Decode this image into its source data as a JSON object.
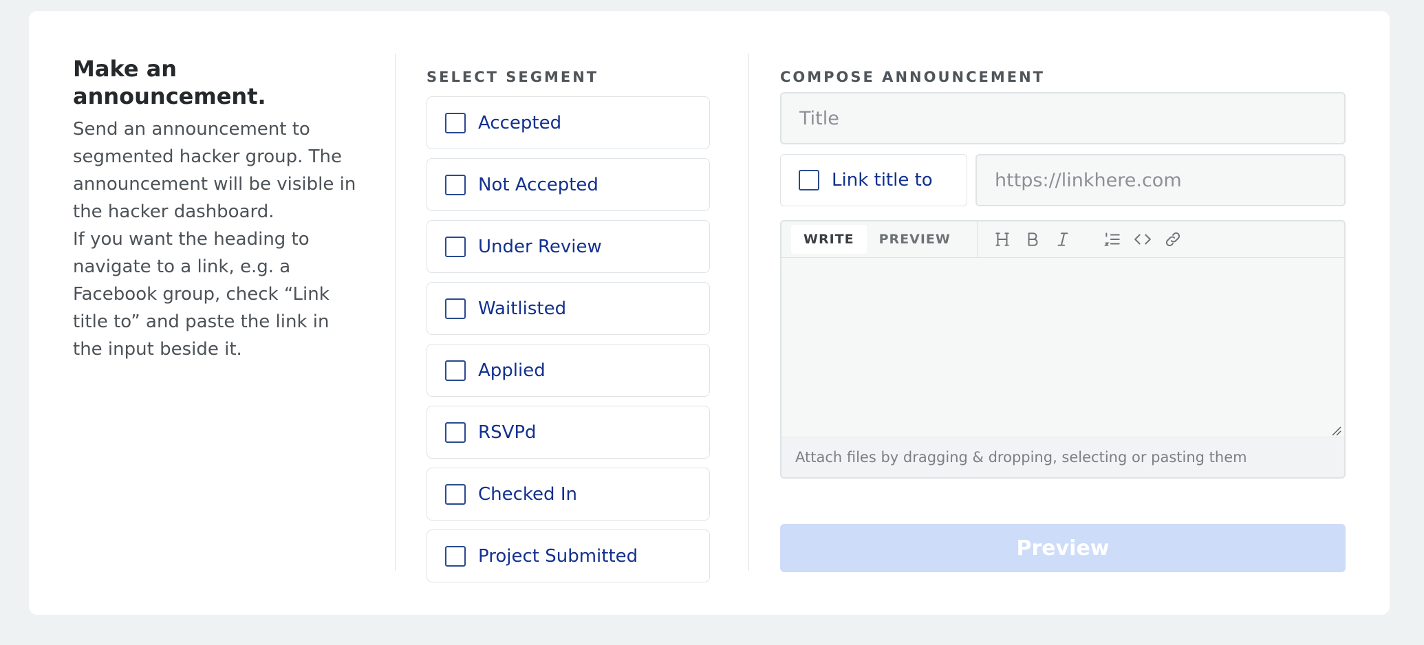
{
  "intro": {
    "title": "Make an announcement.",
    "paragraph1": "Send an announcement to segmented hacker group. The announcement will be visible in the hacker dashboard.",
    "paragraph2": "If you want the heading to navigate to a link, e.g. a Facebook group, check “Link title to” and paste the link in the input beside it."
  },
  "segment": {
    "label": "SELECT SEGMENT",
    "items": [
      {
        "label": "Accepted",
        "checked": false
      },
      {
        "label": "Not Accepted",
        "checked": false
      },
      {
        "label": "Under Review",
        "checked": false
      },
      {
        "label": "Waitlisted",
        "checked": false
      },
      {
        "label": "Applied",
        "checked": false
      },
      {
        "label": "RSVPd",
        "checked": false
      },
      {
        "label": "Checked In",
        "checked": false
      },
      {
        "label": "Project Submitted",
        "checked": false
      }
    ]
  },
  "compose": {
    "label": "COMPOSE ANNOUNCEMENT",
    "title_placeholder": "Title",
    "title_value": "",
    "link_toggle_label": "Link title to",
    "link_toggle_checked": false,
    "link_placeholder": "https://linkhere.com",
    "link_value": "",
    "editor": {
      "tabs": [
        {
          "label": "WRITE",
          "active": true
        },
        {
          "label": "PREVIEW",
          "active": false
        }
      ],
      "tools": [
        "heading-icon",
        "bold-icon",
        "italic-icon",
        "ordered-list-icon",
        "code-icon",
        "link-icon"
      ],
      "body": "",
      "footer_text": "Attach files by dragging & dropping, selecting or pasting them"
    },
    "preview_button_label": "Preview",
    "preview_button_disabled": true
  },
  "colors": {
    "background": "#eff2f3",
    "card": "#ffffff",
    "segment_text": "#12308e",
    "preview_button_disabled": "#cddcf9"
  }
}
